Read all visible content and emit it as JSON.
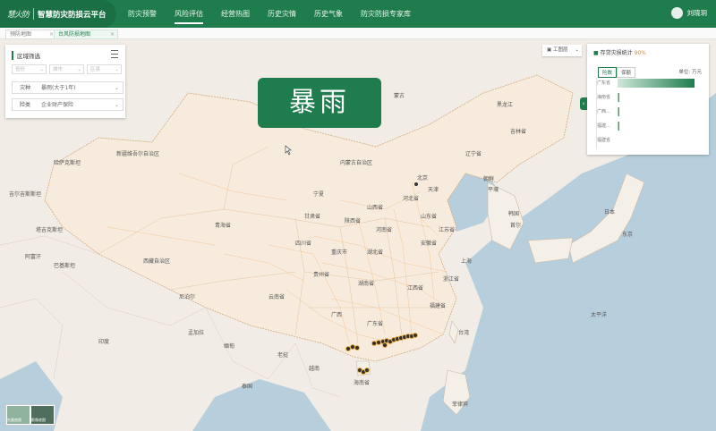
{
  "app": {
    "logo_text": "慧火防",
    "title": "智慧防灾防损云平台"
  },
  "nav": {
    "items": [
      "防灾预警",
      "风险评估",
      "经营热图",
      "历史灾情",
      "历史气象",
      "防灾防损专家库"
    ],
    "active_index": 1
  },
  "user": {
    "name": "刘晓玥"
  },
  "tabs": [
    {
      "label": "预防地图",
      "close": "×"
    },
    {
      "label": "台风防损地图",
      "close": "×"
    }
  ],
  "filter_panel": {
    "title": "区域筛选",
    "province_placeholder": "省份",
    "city_placeholder": "城市",
    "district_placeholder": "区县",
    "disaster_label": "灾种",
    "disaster_value": "暴雨(大于1年)",
    "line_label": "险类",
    "line_value": "企业财产保险"
  },
  "banner": {
    "text": "暴雨"
  },
  "layer_switch": {
    "label": "工图层"
  },
  "stats_panel": {
    "title": "存贷灾损统计",
    "percent": "90%",
    "tab_1": "险数",
    "tab_2": "保额",
    "unit": "单位: 万元",
    "rows": [
      {
        "label": "广东省",
        "value": 1.0
      },
      {
        "label": "海南省",
        "value": 0.02
      },
      {
        "label": "广西...",
        "value": 0.015
      },
      {
        "label": "福建...",
        "value": 0.01
      },
      {
        "label": "福建省",
        "value": 0.0
      }
    ],
    "collapse_icon": "›"
  },
  "basemap_chip": {
    "label_1": "矢量底图",
    "label_2": "影像底图"
  },
  "map_labels": [
    "北京",
    "黑龙江",
    "吉林省",
    "辽宁省",
    "河北省",
    "山西省",
    "陕西省",
    "宁夏",
    "甘肃省",
    "内蒙古自治区",
    "新疆维吾尔自治区",
    "青海省",
    "西藏自治区",
    "四川省",
    "重庆市",
    "贵州省",
    "云南省",
    "广西",
    "广东省",
    "湖南省",
    "湖北省",
    "河南省",
    "安徽省",
    "江苏省",
    "上海",
    "浙江省",
    "江西省",
    "福建省",
    "台湾",
    "海南省",
    "山东省",
    "天津",
    "日本",
    "韩国",
    "朝鲜",
    "蒙古",
    "哈萨克斯坦",
    "吉尔吉斯斯坦",
    "塔吉克斯坦",
    "阿富汗",
    "巴基斯坦",
    "印度",
    "尼泊尔",
    "孟加拉",
    "缅甸",
    "老挝",
    "越南",
    "泰国",
    "菲律宾",
    "太平洋",
    "首尔",
    "东京",
    "平壤"
  ],
  "colors": {
    "brand": "#1f7d4d",
    "accent": "#e08b25",
    "land": "#f1ede6",
    "sea": "#b7cfdd"
  }
}
